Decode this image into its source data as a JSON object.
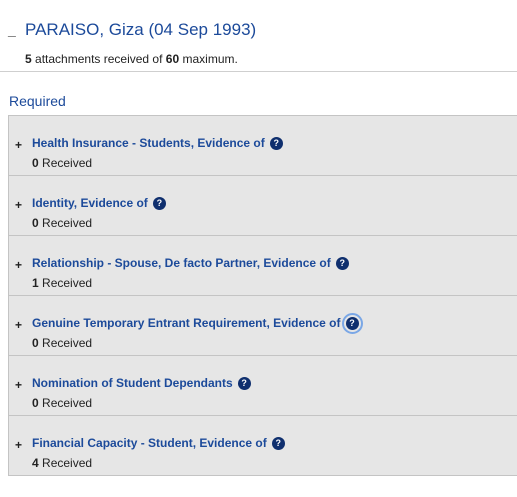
{
  "applicant": {
    "collapse_symbol": "_",
    "name": "PARAISO, Giza (04 Sep 1993)",
    "attachments_received": "5",
    "attachments_text_mid": "attachments received of",
    "attachments_max": "60",
    "attachments_text_end": "maximum."
  },
  "required": {
    "heading": "Required",
    "items": [
      {
        "toggle": "+",
        "title": "Health Insurance - Students, Evidence of",
        "help": "?",
        "count": "0",
        "received_label": "Received"
      },
      {
        "toggle": "+",
        "title": "Identity, Evidence of",
        "help": "?",
        "count": "0",
        "received_label": "Received"
      },
      {
        "toggle": "+",
        "title": "Relationship - Spouse, De facto Partner, Evidence of",
        "help": "?",
        "count": "1",
        "received_label": "Received"
      },
      {
        "toggle": "+",
        "title": "Genuine Temporary Entrant Requirement, Evidence of",
        "help": "?",
        "count": "0",
        "received_label": "Received"
      },
      {
        "toggle": "+",
        "title": "Nomination of Student Dependants",
        "help": "?",
        "count": "0",
        "received_label": "Received"
      },
      {
        "toggle": "+",
        "title": "Financial Capacity - Student, Evidence of",
        "help": "?",
        "count": "4",
        "received_label": "Received"
      }
    ]
  },
  "colors": {
    "link_blue": "#1c4a9a",
    "help_icon": "#0f2f6e",
    "panel_bg": "#e6e6e6",
    "focus_ring": "#7aa7e6"
  },
  "icons": {
    "help": "help-circle-icon",
    "expand": "plus-icon",
    "collapse": "minus-icon"
  }
}
